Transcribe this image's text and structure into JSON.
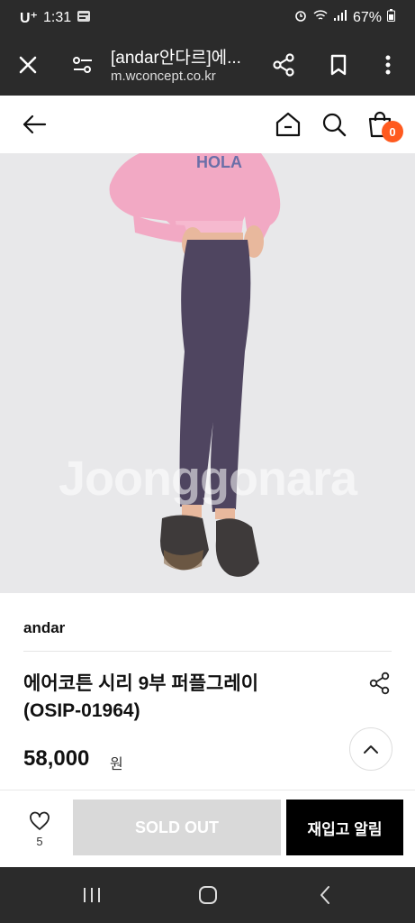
{
  "status_bar": {
    "carrier": "U⁺",
    "time": "1:31",
    "battery": "67%"
  },
  "browser": {
    "page_title": "[andar안다르]에...",
    "url": "m.wconcept.co.kr"
  },
  "header": {
    "cart_count": "0"
  },
  "image": {
    "watermark": "Joonggonara"
  },
  "product": {
    "brand": "andar",
    "name_line1": "에어코튼 시리 9부 퍼플그레이",
    "name_line2": "(OSIP-01964)",
    "price": "58,000",
    "price_unit": "원"
  },
  "bottom_bar": {
    "wish_count": "5",
    "sold_out_label": "SOLD OUT",
    "restock_label": "재입고 알림"
  },
  "colors": {
    "dark_bar": "#2b2b2b",
    "badge": "#ff5a1f",
    "sold_out_bg": "#d9d9d9",
    "restock_bg": "#000000"
  }
}
